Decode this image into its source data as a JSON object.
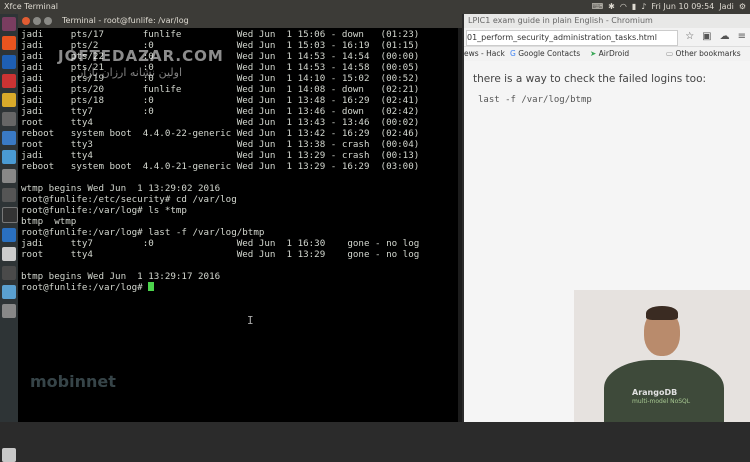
{
  "top_panel": {
    "title": "Xfce Terminal",
    "clock": "Fri Jun 10 09:54",
    "user": "Jadi"
  },
  "terminal": {
    "title": "Terminal - root@funlife: /var/log",
    "lines": [
      "jadi     pts/17       funlife          Wed Jun  1 15:06 - down   (01:23)",
      "jadi     pts/2        :0               Wed Jun  1 15:03 - 16:19  (01:15)",
      "jadi     pts/22       :0               Wed Jun  1 14:53 - 14:54  (00:00)",
      "jadi     pts/21       :0               Wed Jun  1 14:53 - 14:58  (00:05)",
      "jadi     pts/19       :0               Wed Jun  1 14:10 - 15:02  (00:52)",
      "jadi     pts/20       funlife          Wed Jun  1 14:08 - down   (02:21)",
      "jadi     pts/18       :0               Wed Jun  1 13:48 - 16:29  (02:41)",
      "jadi     tty7         :0               Wed Jun  1 13:46 - down   (02:42)",
      "root     tty4                          Wed Jun  1 13:43 - 13:46  (00:02)",
      "reboot   system boot  4.4.0-22-generic Wed Jun  1 13:42 - 16:29  (02:46)",
      "root     tty3                          Wed Jun  1 13:38 - crash  (00:04)",
      "jadi     tty4                          Wed Jun  1 13:29 - crash  (00:13)",
      "reboot   system boot  4.4.0-21-generic Wed Jun  1 13:29 - 16:29  (03:00)",
      "",
      "wtmp begins Wed Jun  1 13:29:02 2016",
      "root@funlife:/etc/security# cd /var/log",
      "root@funlife:/var/log# ls *tmp",
      "btmp  wtmp",
      "root@funlife:/var/log# last -f /var/log/btmp",
      "jadi     tty7         :0               Wed Jun  1 16:30    gone - no log",
      "root     tty4                          Wed Jun  1 13:29    gone - no log",
      "",
      "btmp begins Wed Jun  1 13:29:17 2016",
      "root@funlife:/var/log# "
    ],
    "watermark": "JOFTEDAZAR.COM",
    "watermark_fa": "اولین نشانه ارزان بازار",
    "watermark_bottom": "mobinnet"
  },
  "browser": {
    "title": "LPIC1 exam guide in plain English - Chromium",
    "url": "01_perform_security_administration_tasks.html",
    "bookmarks": [
      "ews - Hack",
      "Google Contacts",
      "AirDroid",
      "Other bookmarks"
    ],
    "content_text": "there is a way to check the failed logins too:",
    "content_code": "last -f /var/log/btmp"
  },
  "webcam": {
    "shirt_text": "ArangoDB",
    "shirt_sub": "multi-model NoSQL"
  },
  "colors": {
    "terminal_bg": "#000000",
    "terminal_fg": "#d3d7cf",
    "cursor": "#4cd44c",
    "panel": "#3c3b37"
  }
}
